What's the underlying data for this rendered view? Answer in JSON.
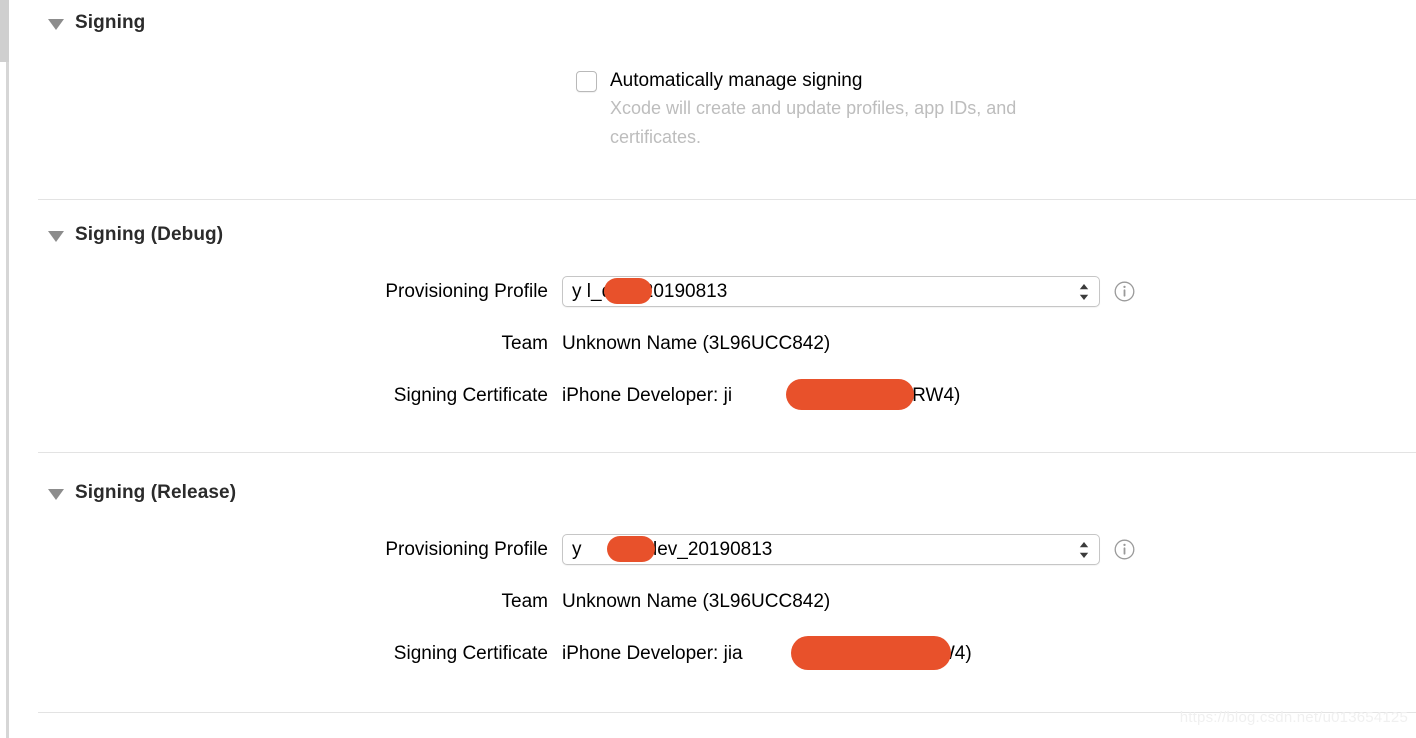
{
  "sections": {
    "signing": {
      "title": "Signing",
      "auto_manage": {
        "label": "Automatically manage signing",
        "hint": "Xcode will create and update profiles, app IDs, and certificates.",
        "checked": "false"
      }
    },
    "signing_debug": {
      "title": "Signing (Debug)",
      "rows": {
        "provisioning_profile": {
          "label": "Provisioning Profile",
          "value": "y        l_dev_20190813",
          "value_prefix": "y",
          "value_suffix": "l_dev_20190813"
        },
        "team": {
          "label": "Team",
          "value": "Unknown Name (3L96UCC842)"
        },
        "signing_certificate": {
          "label": "Signing Certificate",
          "value_prefix": "iPhone Developer: ji",
          "value_suffix": "V64D8RW4)"
        }
      }
    },
    "signing_release": {
      "title": "Signing (Release)",
      "rows": {
        "provisioning_profile": {
          "label": "Provisioning Profile",
          "value_prefix": "y",
          "value_suffix": "_dev_20190813"
        },
        "team": {
          "label": "Team",
          "value": "Unknown Name (3L96UCC842)"
        },
        "signing_certificate": {
          "label": "Signing Certificate",
          "value_prefix": "iPhone Developer: jia",
          "value_suffix": "4D8RW4)"
        }
      }
    }
  },
  "icons": {
    "disclosure": "disclosure-triangle-open",
    "stepper": "updown-chevron",
    "info": "info-circle"
  },
  "colors": {
    "redaction": "#e8512b",
    "separator": "#e3e3e3",
    "hint_text": "#bdbdbd",
    "heading_text": "#2b2b2b"
  },
  "watermark": "https://blog.csdn.net/u013654125"
}
